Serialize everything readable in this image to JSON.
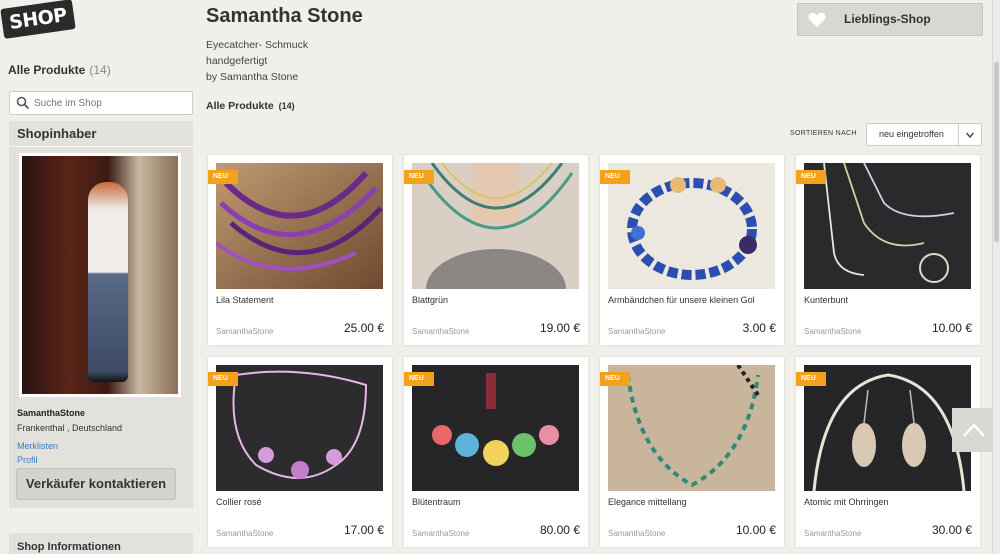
{
  "sidebar": {
    "logo": "SHOP",
    "all_products_label": "Alle Produkte",
    "all_products_count": "(14)",
    "search_placeholder": "Suche im Shop",
    "owner_heading": "Shopinhaber",
    "owner_name": "SamanthaStone",
    "owner_location": "Frankenthal , Deutschland",
    "link_merklisten": "Merklisten",
    "link_profil": "Profil",
    "contact_button": "Verkäufer kontaktieren",
    "shop_info_heading": "Shop Informationen"
  },
  "header": {
    "title": "Samantha Stone",
    "desc_line1": "Eyecatcher- Schmuck",
    "desc_line2": "handgefertigt",
    "desc_line3": "by Samantha Stone",
    "products_label": "Alle Produkte",
    "products_count": "(14)",
    "fav_button": "Lieblings-Shop",
    "sort_label": "SORTIEREN NACH",
    "sort_value": "neu eingetroffen"
  },
  "badge_text": "NEU",
  "products": [
    {
      "name": "Lila Statement",
      "seller": "SamanthaStone",
      "price": "25.00 €"
    },
    {
      "name": "Blattgrün",
      "seller": "SamanthaStone",
      "price": "19.00 €"
    },
    {
      "name": "Armbändchen für unsere kleinen Gol",
      "seller": "SamanthaStone",
      "price": "3.00 €"
    },
    {
      "name": "Kunterbunt",
      "seller": "SamanthaStone",
      "price": "10.00 €"
    },
    {
      "name": "Collier rosé",
      "seller": "SamanthaStone",
      "price": "17.00 €"
    },
    {
      "name": "Blütentraum",
      "seller": "SamanthaStone",
      "price": "80.00 €"
    },
    {
      "name": "Elegance mittellang",
      "seller": "SamanthaStone",
      "price": "10.00 €"
    },
    {
      "name": "Atomic mit Ohrringen",
      "seller": "SamanthaStone",
      "price": "30.00 €"
    }
  ],
  "colors": {
    "background": "#f1efea",
    "badge": "#f4a21b",
    "link": "#3a7bbf",
    "panel": "#e3e1dc"
  }
}
